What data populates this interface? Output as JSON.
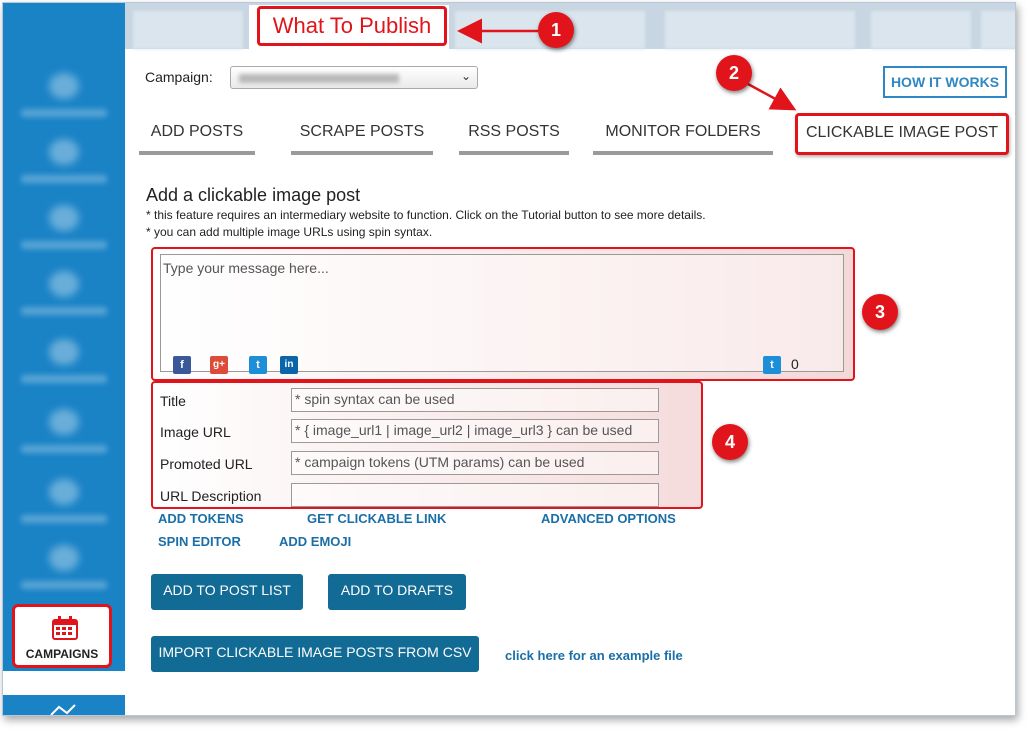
{
  "nav": {
    "active_tab": "What To Publish",
    "campaigns_label": "CAMPAIGNS"
  },
  "markers": [
    "1",
    "2",
    "3",
    "4"
  ],
  "campaign": {
    "label": "Campaign:"
  },
  "how_it_works": "HOW IT WORKS",
  "subtabs": [
    "ADD POSTS",
    "SCRAPE POSTS",
    "RSS POSTS",
    "MONITOR FOLDERS",
    "CLICKABLE IMAGE POST"
  ],
  "section": {
    "title": "Add a clickable image post",
    "note1": "* this feature requires an intermediary website to function. Click on the Tutorial button to see more details.",
    "note2": "* you can add multiple image URLs using spin syntax."
  },
  "message": {
    "placeholder": "Type your message here...",
    "twitter_count": "0"
  },
  "social_icons": [
    "facebook-icon",
    "google-plus-icon",
    "twitter-icon",
    "linkedin-icon"
  ],
  "form": {
    "title_label": "Title",
    "title_placeholder": "* spin syntax can be used",
    "image_url_label": "Image URL",
    "image_url_placeholder": "* { image_url1 | image_url2 | image_url3 } can be used",
    "promoted_url_label": "Promoted URL",
    "promoted_url_placeholder": "* campaign tokens (UTM params) can be used",
    "url_description_label": "URL Description",
    "url_description_placeholder": ""
  },
  "links": {
    "add_tokens": "ADD TOKENS",
    "get_clickable_link": "GET CLICKABLE LINK",
    "advanced_options": "ADVANCED OPTIONS",
    "spin_editor": "SPIN EDITOR",
    "add_emoji": "ADD EMOJI",
    "example_file": "click here for an example file"
  },
  "buttons": {
    "add_to_post_list": "ADD TO POST LIST",
    "add_to_drafts": "ADD TO DRAFTS",
    "import_csv": "IMPORT CLICKABLE IMAGE POSTS FROM CSV"
  },
  "colors": {
    "sidebar": "#1a83c6",
    "highlight": "#e0141a",
    "button": "#126b94",
    "link": "#1a6fa8"
  }
}
